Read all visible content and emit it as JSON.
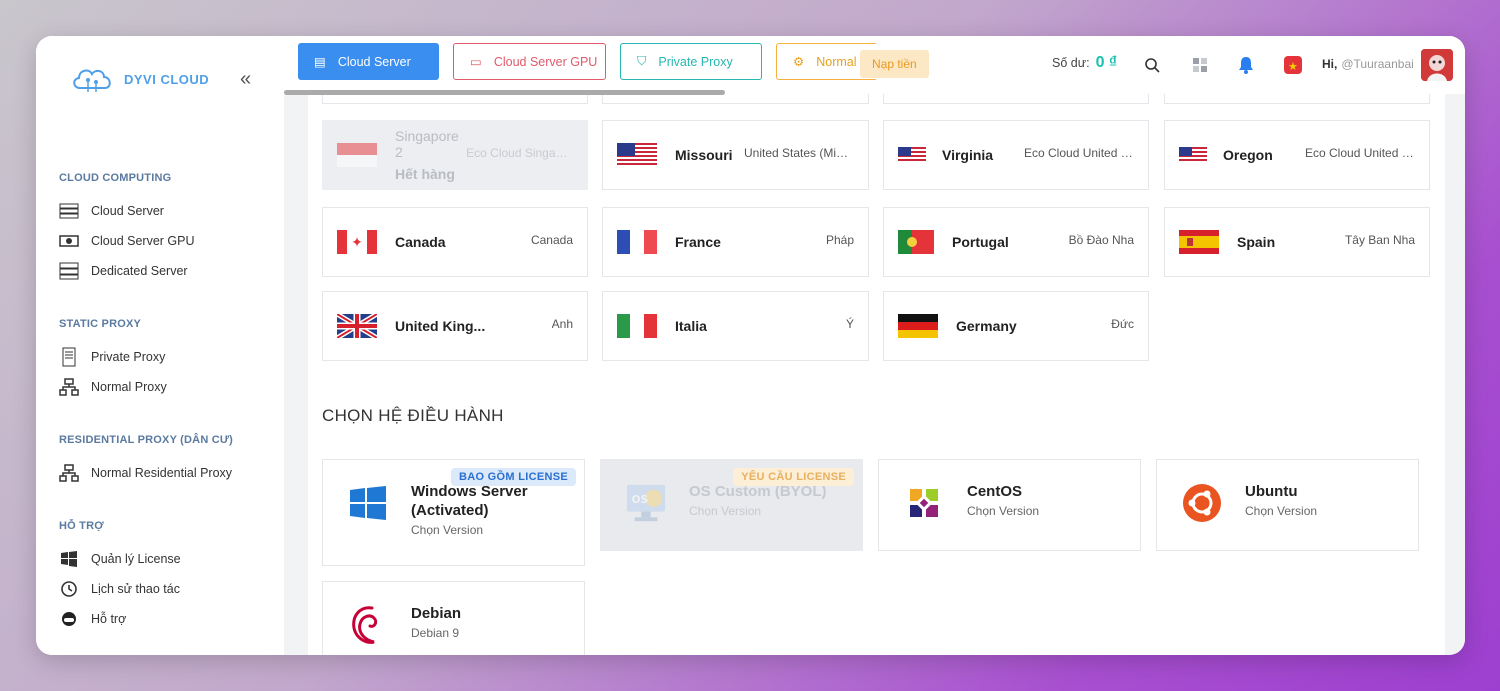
{
  "app": {
    "logo_text": "DYVI CLOUD"
  },
  "sidebar": {
    "sections": [
      {
        "title": "CLOUD COMPUTING",
        "items": [
          "Cloud Server",
          "Cloud Server GPU",
          "Dedicated Server"
        ]
      },
      {
        "title": "STATIC PROXY",
        "items": [
          "Private Proxy",
          "Normal Proxy"
        ]
      },
      {
        "title": "RESIDENTIAL PROXY (DÂN CƯ)",
        "items": [
          "Normal Residential Proxy"
        ]
      },
      {
        "title": "HỖ TRỢ",
        "items": [
          "Quản lý License",
          "Lịch sử thao tác",
          "Hỗ trợ"
        ]
      }
    ]
  },
  "topbar": {
    "tabs": [
      "Cloud Server",
      "Cloud Server GPU",
      "Private Proxy",
      "Normal Proxy"
    ],
    "napp_label": "Nạp tiền",
    "balance_label": "Số dư:",
    "balance_value": "0 ₫",
    "greeting": "Hi,",
    "username": "@Tuuraanbai"
  },
  "locations": [
    {
      "name": "Singapore 2",
      "status": "Hết hàng",
      "sub": "Eco Cloud Singapore",
      "disabled": true
    },
    {
      "name": "Missouri",
      "sub": "United States (Missouri)"
    },
    {
      "name": "Virginia",
      "sub": "Eco Cloud United States"
    },
    {
      "name": "Oregon",
      "sub": "Eco Cloud United States"
    },
    {
      "name": "Canada",
      "sub": "Canada"
    },
    {
      "name": "France",
      "sub": "Pháp"
    },
    {
      "name": "Portugal",
      "sub": "Bồ Đào Nha"
    },
    {
      "name": "Spain",
      "sub": "Tây Ban Nha"
    },
    {
      "name": "United King...",
      "sub": "Anh"
    },
    {
      "name": "Italia",
      "sub": "Ý"
    },
    {
      "name": "Germany",
      "sub": "Đức"
    }
  ],
  "os_section": {
    "heading": "CHỌN HỆ ĐIỀU HÀNH",
    "items": [
      {
        "title_line1": "Windows Server",
        "title_line2": "(Activated)",
        "version": "Chọn Version",
        "badge": "BAO GỒM LICENSE"
      },
      {
        "title_line1": "OS Custom (BYOL)",
        "version": "Chọn Version",
        "badge": "YÊU CẦU LICENSE",
        "disabled": true
      },
      {
        "title_line1": "CentOS",
        "version": "Chọn Version"
      },
      {
        "title_line1": "Ubuntu",
        "version": "Chọn Version"
      },
      {
        "title_line1": "Debian",
        "version": "Debian 9"
      }
    ]
  },
  "colors": {
    "primary": "#3a8ef0",
    "gpu": "#e05a6a",
    "proxy": "#26b7b0",
    "normal": "#f5b040",
    "balance": "#1cc0b0"
  }
}
